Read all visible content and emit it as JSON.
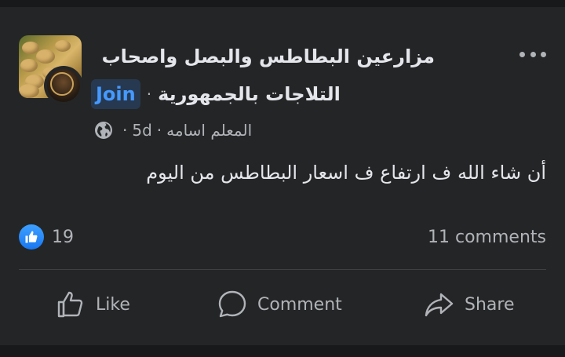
{
  "post": {
    "group_name_line1": "مزارعين  البطاطس والبصل واصحاب",
    "group_name_line2": "التلاجات بالجمهورية",
    "join_label": "Join",
    "separator": "·",
    "author": "المعلم اسامه",
    "time": "5d",
    "privacy_icon": "globe-icon",
    "more_icon": "more-options-icon",
    "text": "أن شاء الله ف ارتفاع ف اسعار البطاطس من اليوم"
  },
  "stats": {
    "reaction_icon": "like-reaction-icon",
    "reaction_count": "19",
    "comments": "11 comments"
  },
  "actions": {
    "like": "Like",
    "comment": "Comment",
    "share": "Share"
  },
  "colors": {
    "background": "#18191a",
    "card": "#242526",
    "primary_text": "#e4e6eb",
    "secondary_text": "#b0b3b8",
    "join_text": "#4599ff",
    "join_bg": "#263951",
    "like_blue": "#1877f2",
    "divider": "#3e4042"
  }
}
